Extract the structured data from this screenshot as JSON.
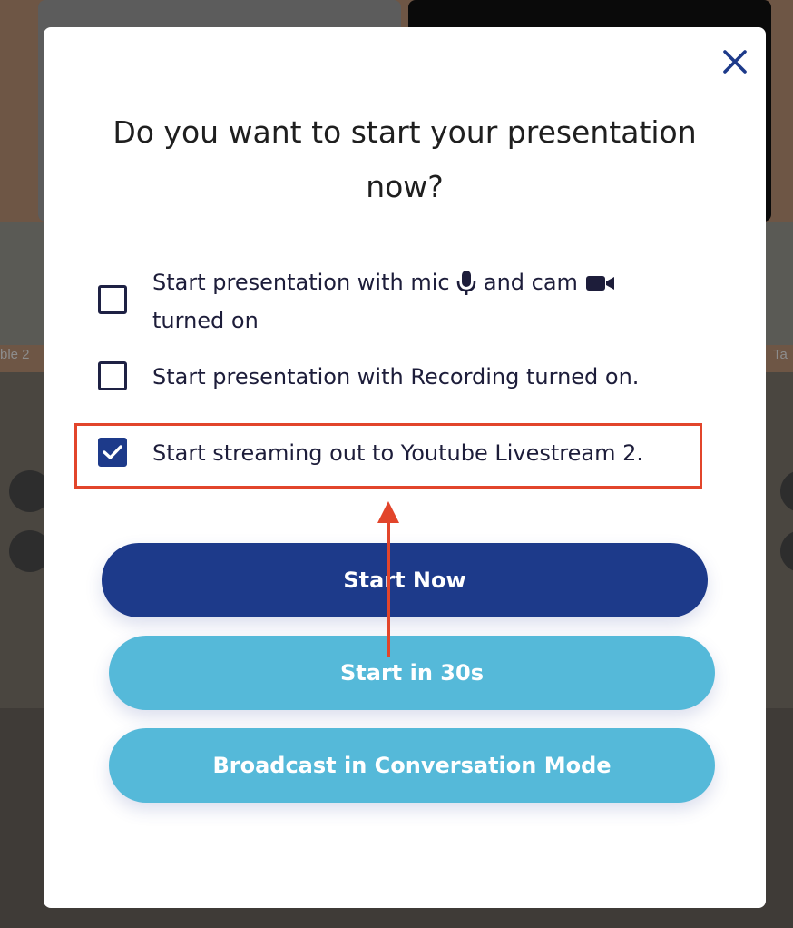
{
  "background": {
    "left_label": "ble 2",
    "right_label": "Ta"
  },
  "modal": {
    "title": "Do you want to start your presentation now?",
    "close_icon": "close-icon",
    "options": [
      {
        "text_part1": "Start presentation with mic",
        "text_part2": "and cam",
        "text_part3": "turned on",
        "checked": false,
        "icons": [
          "microphone-icon",
          "video-camera-icon"
        ]
      },
      {
        "text": "Start presentation with Recording turned on.",
        "checked": false
      },
      {
        "text": "Start streaming out to Youtube Livestream 2.",
        "checked": true
      }
    ],
    "buttons": {
      "start_now": "Start Now",
      "start_30s": "Start in 30s",
      "broadcast": "Broadcast in Conversation Mode"
    }
  },
  "colors": {
    "primary": "#1d3a8a",
    "secondary": "#55b9d9",
    "highlight": "#e2452b",
    "text": "#1d1d3a"
  }
}
